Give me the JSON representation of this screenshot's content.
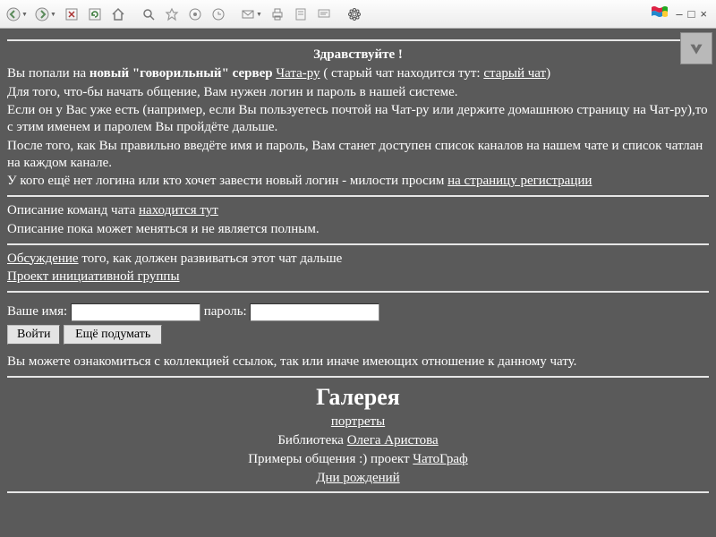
{
  "greeting": "Здравствуйте !",
  "intro": {
    "you_arrived": "Вы попали на ",
    "new_server_bold": "новый \"говорильный\" сервер ",
    "chat_ru_link": "Чата-ру",
    "old_chat_pre": " ( старый чат находится тут: ",
    "old_chat_link": "старый чат",
    "old_chat_post": ")"
  },
  "p2": "Для того, что-бы начать общение, Вам нужен логин и пароль в нашей системе.",
  "p3": "Если он у Вас уже есть (например, если Вы пользуетесь почтой на Чат-ру или держите домашнюю страницу на Чат-ру),то с этим именем и паролем Вы пройдёте дальше.",
  "p4": "После того, как Вы правильно введёте имя и пароль, Вам станет доступен список каналов на нашем чате и список чатлан на каждом канале.",
  "p5_pre": "У кого ещё нет логина или кто хочет завести новый логин - милости просим ",
  "p5_link": "на страницу регистрации",
  "cmds_pre": "Описание команд чата ",
  "cmds_link": "находится тут",
  "cmds_note": "Описание пока может меняться и не является полным.",
  "discuss_link": "Обсуждение",
  "discuss_post": " того, как должен развиваться этот чат дальше",
  "initiative_link": "Проект инициативной группы",
  "form": {
    "name_label": "Ваше имя: ",
    "pass_label": " пароль: ",
    "submit": "Войти",
    "cancel": "Ещё подумать"
  },
  "links_note": "Вы можете ознакомиться с коллекцией ссылок, так или иначе имеющих отношение к данному чату.",
  "gallery": {
    "title": "Галерея",
    "portraits": "портреты",
    "lib_pre": "Библиотека ",
    "lib_link": "Олега Аристова",
    "examples_pre": "Примеры общения :) проект ",
    "examples_link": "ЧатоГраф",
    "birthdays": "Дни рождений"
  }
}
